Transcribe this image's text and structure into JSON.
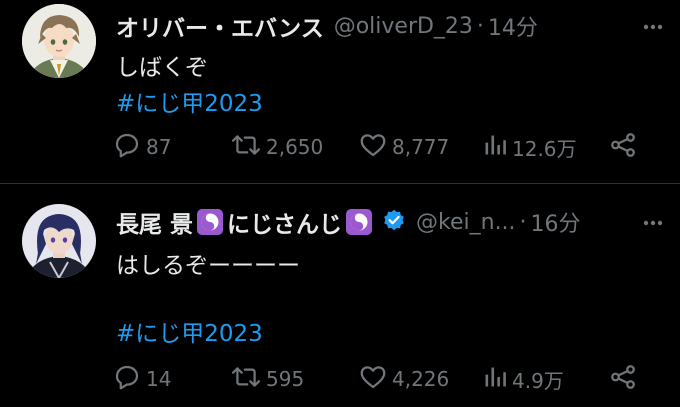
{
  "tweets": [
    {
      "name": "オリバー・エバンス",
      "handle": "@oliverD_23",
      "separator": "·",
      "time": "14分",
      "text": "しばくぞ",
      "hashtag": "#にじ甲2023",
      "replies": "87",
      "retweets": "2,650",
      "likes": "8,777",
      "views": "12.6万"
    },
    {
      "name_part1": "長尾 景",
      "name_part2": "にじさんじ",
      "handle": "@kei_n...",
      "separator": "·",
      "time": "16分",
      "text": "はしるぞーーーー",
      "hashtag": "#にじ甲2023",
      "replies": "14",
      "retweets": "595",
      "likes": "4,226",
      "views": "4.9万"
    }
  ],
  "colors": {
    "background": "#000000",
    "text": "#e7e9ea",
    "muted": "#71767b",
    "link": "#1d9bf0",
    "divider": "#2f3336",
    "emoji_bg": "#9b59d0"
  },
  "icons": [
    "reply-icon",
    "retweet-icon",
    "like-icon",
    "views-icon",
    "share-icon",
    "more-icon",
    "verified-badge-icon",
    "yin-yang-icon"
  ]
}
